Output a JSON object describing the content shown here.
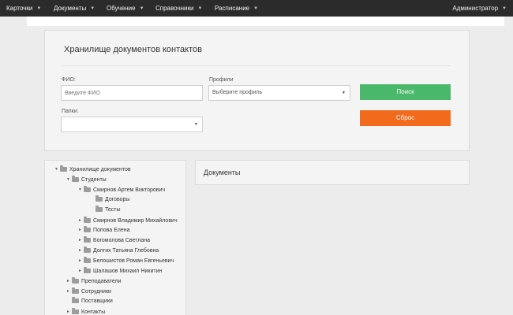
{
  "nav": {
    "items": [
      {
        "label": "Карточки"
      },
      {
        "label": "Документы"
      },
      {
        "label": "Обучение"
      },
      {
        "label": "Справочники"
      },
      {
        "label": "Расписание"
      }
    ],
    "user": "Администратор"
  },
  "search_panel": {
    "title": "Хранилище документов контактов",
    "fio": {
      "label": "ФИО:",
      "placeholder": "Введите ФИО",
      "value": ""
    },
    "profiles": {
      "label": "Профили",
      "selected": "Выберите профиль"
    },
    "folders": {
      "label": "Папки:",
      "selected": ""
    },
    "search_button": "Поиск",
    "reset_button": "Сброс"
  },
  "tree": {
    "nodes": [
      {
        "label": "Хранилище документов",
        "caret": "▼",
        "folder": "open",
        "depth": 0
      },
      {
        "label": "Студенты",
        "caret": "▼",
        "folder": "open",
        "depth": 1
      },
      {
        "label": "Смирнов Артем Викторович",
        "caret": "▼",
        "folder": "open",
        "depth": 2
      },
      {
        "label": "Договоры",
        "caret": "",
        "folder": "closed",
        "depth": 3
      },
      {
        "label": "Тесты",
        "caret": "",
        "folder": "closed",
        "depth": 3
      },
      {
        "label": "Смирнов Владимир Михайлович",
        "caret": "►",
        "folder": "closed",
        "depth": 2
      },
      {
        "label": "Попова Елена",
        "caret": "►",
        "folder": "closed",
        "depth": 2
      },
      {
        "label": "Богомолова Светлана",
        "caret": "►",
        "folder": "closed",
        "depth": 2
      },
      {
        "label": "Долгих Татьяна Глебовна",
        "caret": "►",
        "folder": "closed",
        "depth": 2
      },
      {
        "label": "Белошистов Роман Евгеньевич",
        "caret": "►",
        "folder": "closed",
        "depth": 2
      },
      {
        "label": "Шалашов Михаил Никитин",
        "caret": "►",
        "folder": "closed",
        "depth": 2
      },
      {
        "label": "Преподаватели",
        "caret": "►",
        "folder": "closed",
        "depth": 1
      },
      {
        "label": "Сотрудники",
        "caret": "►",
        "folder": "closed",
        "depth": 1
      },
      {
        "label": "Поставщики",
        "caret": "",
        "folder": "closed",
        "depth": 1
      },
      {
        "label": "Контакты",
        "caret": "►",
        "folder": "closed",
        "depth": 1
      }
    ]
  },
  "documents_panel": {
    "title": "Документы"
  },
  "colors": {
    "topbar": "#2b2b2b",
    "search_button": "#4ab86a",
    "reset_button": "#f26a1b",
    "panel_background": "#f4f4f4",
    "page_background": "#ececec"
  },
  "icons": {
    "nav_caret": "chevron-down-icon",
    "tree_expanded": "triangle-down-icon",
    "tree_collapsed": "triangle-right-icon",
    "tree_folder": "folder-icon",
    "select_caret": "select-caret-icon"
  }
}
